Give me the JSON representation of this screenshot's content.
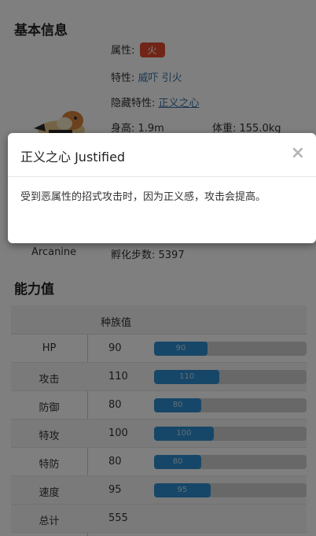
{
  "basic_info": {
    "title": "基本信息",
    "type_label": "属性:",
    "type_value": "火",
    "ability_label": "特性:",
    "abilities": [
      "威吓",
      "引火"
    ],
    "hidden_ability_label": "隐藏特性:",
    "hidden_ability": "正义之心",
    "height": "身高: 1.9m",
    "weight": "体重: 155.0kg",
    "name_en": "Arcanine",
    "egg_steps": "孵化步数: 5397"
  },
  "stats": {
    "title": "能力值",
    "column_header": "种族值",
    "rows": [
      {
        "name": "HP",
        "value": "90",
        "fill": 0.35
      },
      {
        "name": "攻击",
        "value": "110",
        "fill": 0.43
      },
      {
        "name": "防御",
        "value": "80",
        "fill": 0.31
      },
      {
        "name": "特攻",
        "value": "100",
        "fill": 0.39
      },
      {
        "name": "特防",
        "value": "80",
        "fill": 0.31
      },
      {
        "name": "速度",
        "value": "95",
        "fill": 0.37
      }
    ],
    "total_label": "总计",
    "total_value": "555"
  },
  "modal": {
    "title": "正义之心 Justified",
    "close": "×",
    "body": "受到恶属性的招式攻击时，因为正义感，攻击会提高。"
  },
  "colors": {
    "fire_badge": "#e24a2e",
    "bar_fill": "#2c8fd0",
    "link": "#3a73a8"
  }
}
